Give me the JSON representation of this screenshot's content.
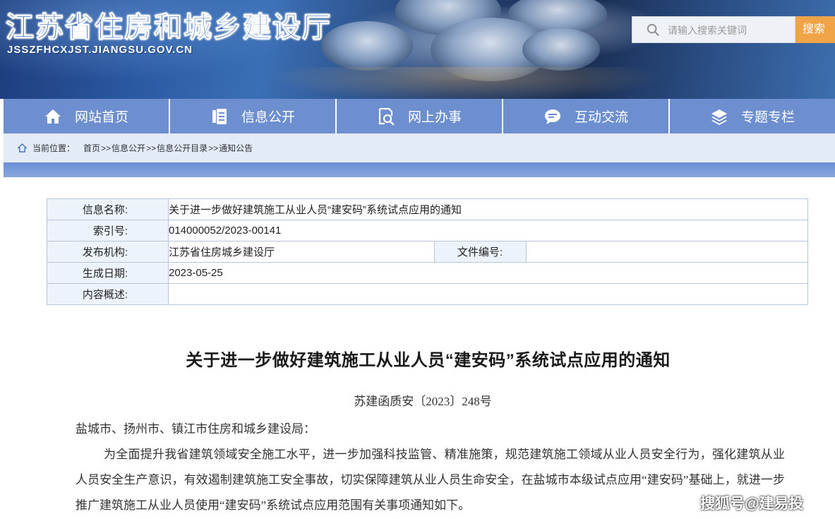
{
  "header": {
    "site_title": "江苏省住房和城乡建设厅",
    "site_url": "JSSZFHCXJST.JIANGSU.GOV.CN",
    "search_placeholder": "请输入搜索关键词",
    "search_button": "搜索"
  },
  "nav": [
    {
      "label": "网站首页",
      "icon": "home-icon"
    },
    {
      "label": "信息公开",
      "icon": "document-icon"
    },
    {
      "label": "网上办事",
      "icon": "search-doc-icon"
    },
    {
      "label": "互动交流",
      "icon": "chat-icon"
    },
    {
      "label": "专题专栏",
      "icon": "layers-icon"
    }
  ],
  "breadcrumb": {
    "label": "当前位置：",
    "items": [
      "首页",
      "信息公开",
      "信息公开目录",
      "通知公告"
    ],
    "separator": ">>"
  },
  "info": {
    "name_label": "信息名称:",
    "name_value": "关于进一步做好建筑施工从业人员“建安码”系统试点应用的通知",
    "index_label": "索引号:",
    "index_value": "014000052/2023-00141",
    "org_label": "发布机构:",
    "org_value": "江苏省住房城乡建设厅",
    "file_no_label": "文件编号:",
    "file_no_value": "",
    "date_label": "生成日期:",
    "date_value": "2023-05-25",
    "summary_label": "内容概述:",
    "summary_value": ""
  },
  "article": {
    "title": "关于进一步做好建筑施工从业人员“建安码”系统试点应用的通知",
    "doc_number": "苏建函质安〔2023〕248号",
    "addressee": "盐城市、扬州市、镇江市住房和城乡建设局：",
    "paragraph": "为全面提升我省建筑领域安全施工水平，进一步加强科技监管、精准施策，规范建筑施工领域从业人员安全行为，强化建筑从业人员安全生产意识，有效遏制建筑施工安全事故，切实保障建筑从业人员生命安全，在盐城市本级试点应用“建安码”基础上，就进一步推广建筑施工从业人员使用“建安码”系统试点应用范围有关事项通知如下。"
  },
  "watermark": "搜狐号@建易投"
}
